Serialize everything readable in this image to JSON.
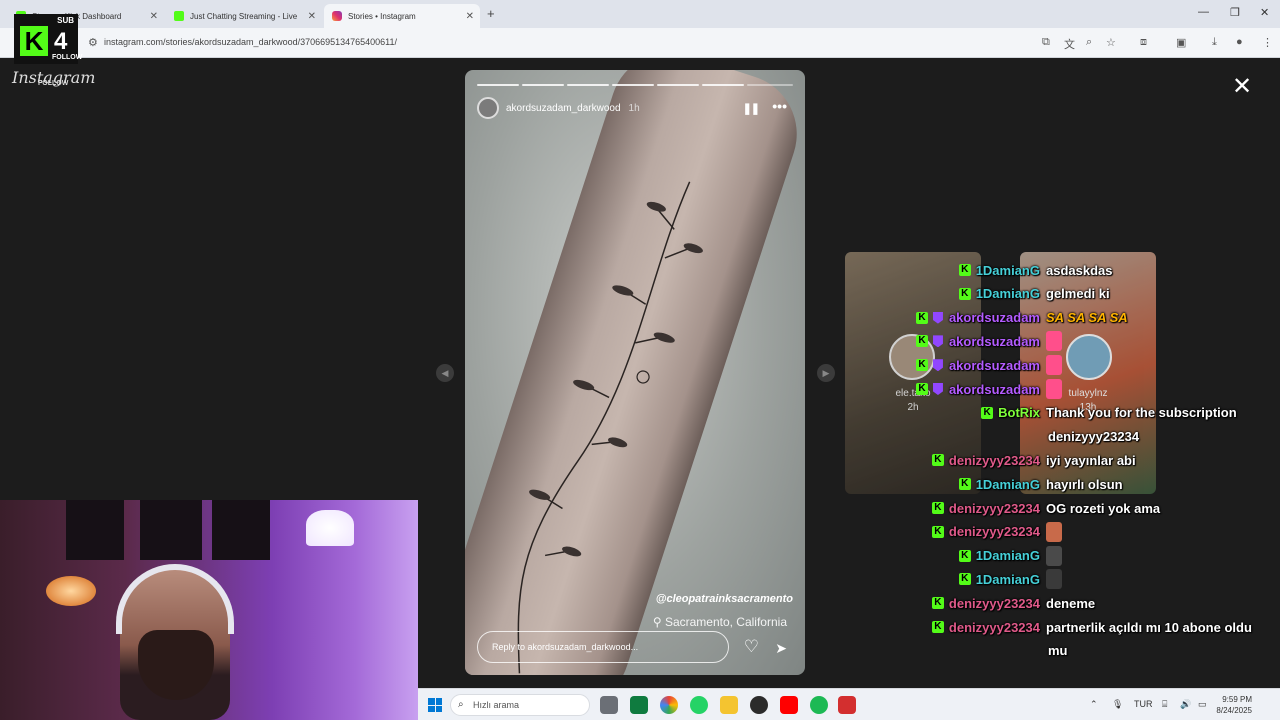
{
  "browser": {
    "tabs": [
      {
        "label": "Stream - Kick Dashboard",
        "favicon": "kick-icon",
        "active": false
      },
      {
        "label": "Just Chatting Streaming - Live",
        "favicon": "kick-icon",
        "active": false
      },
      {
        "label": "Stories • Instagram",
        "favicon": "instagram-icon",
        "active": true
      }
    ],
    "new_tab": "+",
    "url": "instagram.com/stories/akordsuzadam_darkwood/3706695134765400611/"
  },
  "overlay": {
    "sub_label": "SUB",
    "kick_letter": "K",
    "count": "4",
    "follow_label": "FOLLOW",
    "instagram_label": "Instagram"
  },
  "story": {
    "username": "akordsuzadam_darkwood",
    "time": "1h",
    "tag": "@cleopatrainksacramento",
    "location": "Sacramento, California",
    "reply_placeholder": "Reply to akordsuzadam_darkwood...",
    "segments": 7,
    "close": "✕"
  },
  "previews": [
    {
      "name": "ele.tako",
      "time": "2h"
    },
    {
      "name": "tulayylnz",
      "time": "13h"
    }
  ],
  "chat": [
    {
      "user": "1DamianG",
      "text": "asdaskdas",
      "color": "#46d0d8"
    },
    {
      "user": "1DamianG",
      "text": "gelmedi ki",
      "color": "#46d0d8"
    },
    {
      "user": "akordsuzadam",
      "text": "SA SA SA SA",
      "color": "#b45cff",
      "text_color": "#ffb300",
      "extra_badge": true
    },
    {
      "user": "akordsuzadam",
      "text": "",
      "color": "#b45cff",
      "emote": "#ff4f8b",
      "extra_badge": true
    },
    {
      "user": "akordsuzadam",
      "text": "",
      "color": "#b45cff",
      "emote": "#ff4f8b",
      "extra_badge": true
    },
    {
      "user": "akordsuzadam",
      "text": "",
      "color": "#b45cff",
      "emote": "#ff4f8b",
      "extra_badge": true
    },
    {
      "user": "BotRix",
      "text": "Thank you for the subscription",
      "color": "#7fff3a"
    },
    {
      "user": "",
      "text": "denizyyy23234",
      "color": "#ffffff"
    },
    {
      "user": "denizyyy23234",
      "text": "iyi yayınlar abi",
      "color": "#e05a8a"
    },
    {
      "user": "1DamianG",
      "text": "hayırlı olsun",
      "color": "#46d0d8"
    },
    {
      "user": "denizyyy23234",
      "text": "OG rozeti yok ama",
      "color": "#e05a8a"
    },
    {
      "user": "denizyyy23234",
      "text": "",
      "color": "#e05a8a",
      "emote": "#c86a4a"
    },
    {
      "user": "1DamianG",
      "text": "",
      "color": "#46d0d8",
      "emote": "#4a4a4a"
    },
    {
      "user": "1DamianG",
      "text": "",
      "color": "#46d0d8",
      "emote": "#3a3a3a"
    },
    {
      "user": "denizyyy23234",
      "text": "deneme",
      "color": "#e05a8a"
    },
    {
      "user": "denizyyy23234",
      "text": "partnerlik açıldı mı 10 abone oldu",
      "color": "#e05a8a"
    },
    {
      "user": "",
      "text": "mu",
      "color": "#ffffff"
    }
  ],
  "taskbar": {
    "search_placeholder": "Hızlı arama",
    "lang": "TUR",
    "time": "9:59 PM",
    "date": "8/24/2025"
  }
}
